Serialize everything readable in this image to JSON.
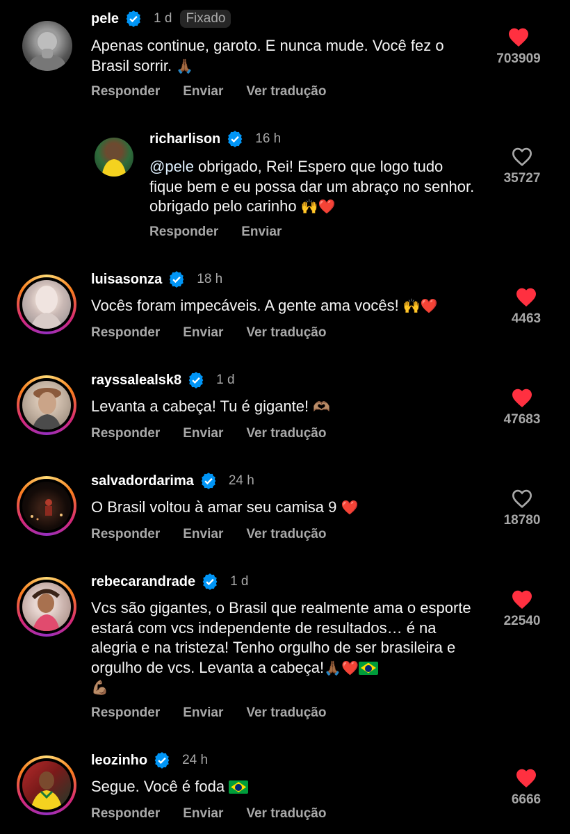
{
  "actions": {
    "reply": "Responder",
    "send": "Enviar",
    "translate": "Ver tradução"
  },
  "colors": {
    "like_red": "#ff3040",
    "verified_blue": "#0095f6",
    "muted": "#a8a8a8"
  },
  "comments": [
    {
      "username": "pele",
      "time": "1 d",
      "pinned": "Fixado",
      "text": "Apenas continue, garoto. E nunca mude. Você fez o Brasil sorrir.",
      "emoji": "🙏🏾",
      "likes": "703909",
      "liked": true
    },
    {
      "username": "richarlison",
      "time": "16 h",
      "mention": "@pele",
      "text": " obrigado, Rei! Espero que logo tudo fique bem e eu possa dar um abraço no senhor. obrigado pelo carinho",
      "emoji": "🙌❤️",
      "likes": "35727",
      "liked": false
    },
    {
      "username": "luisasonza",
      "time": "18 h",
      "text": "Vocês foram impecáveis. A gente ama vocês!",
      "emoji": "🙌❤️",
      "likes": "4463",
      "liked": true
    },
    {
      "username": "rayssalealsk8",
      "time": "1 d",
      "text": "Levanta a cabeça! Tu é gigante!",
      "emoji": "🫶🏽",
      "likes": "47683",
      "liked": true
    },
    {
      "username": "salvadordarima",
      "time": "24 h",
      "text": "O Brasil voltou à amar seu camisa 9",
      "emoji": "❤️",
      "likes": "18780",
      "liked": false
    },
    {
      "username": "rebecarandrade",
      "time": "1 d",
      "text": "Vcs são gigantes, o Brasil que realmente ama o esporte estará com vcs independente de resultados… é na alegria e na tristeza! Tenho orgulho de ser brasileira e orgulho de vcs. Levanta a cabeça!",
      "emoji": "🙏🏾❤️",
      "emoji2": "💪🏽",
      "likes": "22540",
      "liked": true
    },
    {
      "username": "leozinho",
      "time": "24 h",
      "text": "Segue. Você é foda",
      "likes": "6666",
      "liked": true
    }
  ]
}
